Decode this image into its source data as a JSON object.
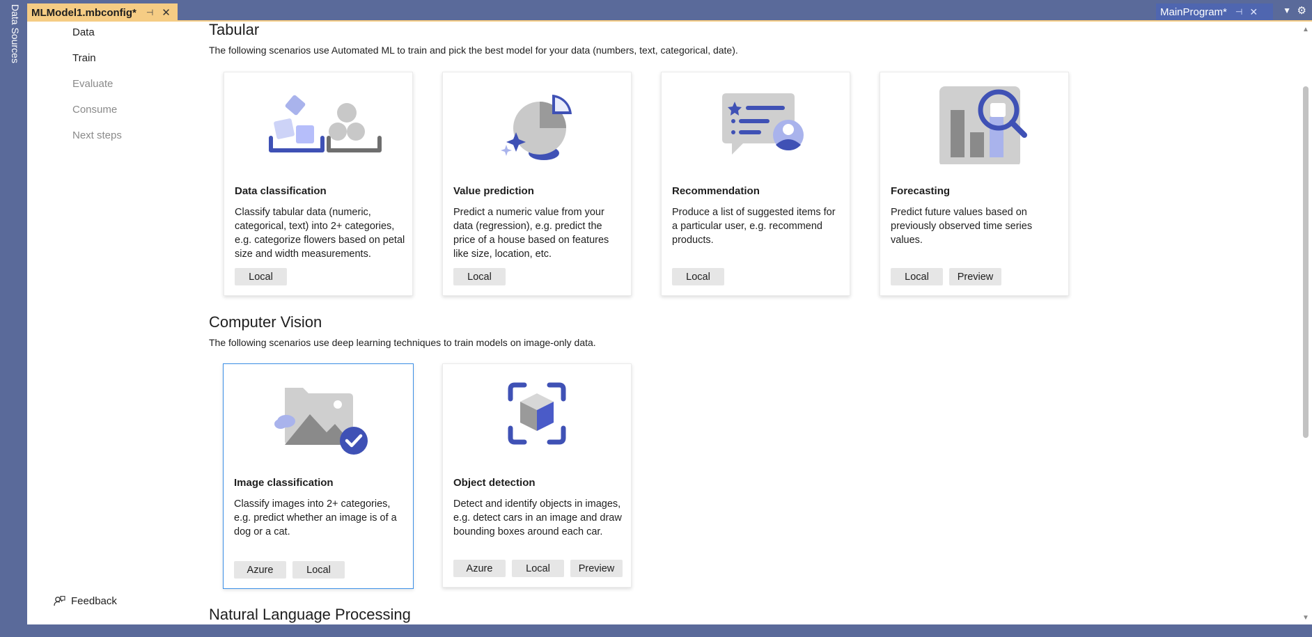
{
  "left_strip": {
    "data_sources_label": "Data Sources"
  },
  "tabs": {
    "document_tab": "MLModel1.mbconfig*",
    "right_tab": "MainProgram*"
  },
  "steps": [
    {
      "label": "Data",
      "active": true
    },
    {
      "label": "Train",
      "active": true
    },
    {
      "label": "Evaluate",
      "active": false
    },
    {
      "label": "Consume",
      "active": false
    },
    {
      "label": "Next steps",
      "active": false
    }
  ],
  "feedback_label": "Feedback",
  "sections": {
    "tabular": {
      "title": "Tabular",
      "description": "The following scenarios use Automated ML to train and pick the best model for your data (numbers, text, categorical, date).",
      "cards": [
        {
          "title": "Data classification",
          "description": "Classify tabular data (numeric, categorical, text) into 2+ categories, e.g. categorize flowers based on petal size and width measurements.",
          "tags": [
            "Local"
          ],
          "icon": "data-classification-icon"
        },
        {
          "title": "Value prediction",
          "description": "Predict a numeric value from your data (regression), e.g. predict the price of a house based on features like size, location, etc.",
          "tags": [
            "Local"
          ],
          "icon": "value-prediction-icon"
        },
        {
          "title": "Recommendation",
          "description": "Produce a list of suggested items for a particular user, e.g. recommend products.",
          "tags": [
            "Local"
          ],
          "icon": "recommendation-icon"
        },
        {
          "title": "Forecasting",
          "description": "Predict future values based on previously observed time series values.",
          "tags": [
            "Local",
            "Preview"
          ],
          "icon": "forecasting-icon"
        }
      ]
    },
    "computer_vision": {
      "title": "Computer Vision",
      "description": "The following scenarios use deep learning techniques to train models on image-only data.",
      "cards": [
        {
          "title": "Image classification",
          "description": "Classify images into 2+ categories, e.g. predict whether an image is of a dog or a cat.",
          "tags": [
            "Azure",
            "Local"
          ],
          "icon": "image-classification-icon",
          "selected": true
        },
        {
          "title": "Object detection",
          "description": "Detect and identify objects in images, e.g. detect cars in an image and draw bounding boxes around each car.",
          "tags": [
            "Azure",
            "Local",
            "Preview"
          ],
          "icon": "object-detection-icon"
        }
      ]
    },
    "nlp": {
      "title": "Natural Language Processing"
    }
  },
  "colors": {
    "chrome": "#5a6a9a",
    "active_tab": "#f5cc84",
    "accent_blue": "#3f51b5",
    "selected_border": "#3a8ee6",
    "tag_bg": "#e6e6e6"
  }
}
